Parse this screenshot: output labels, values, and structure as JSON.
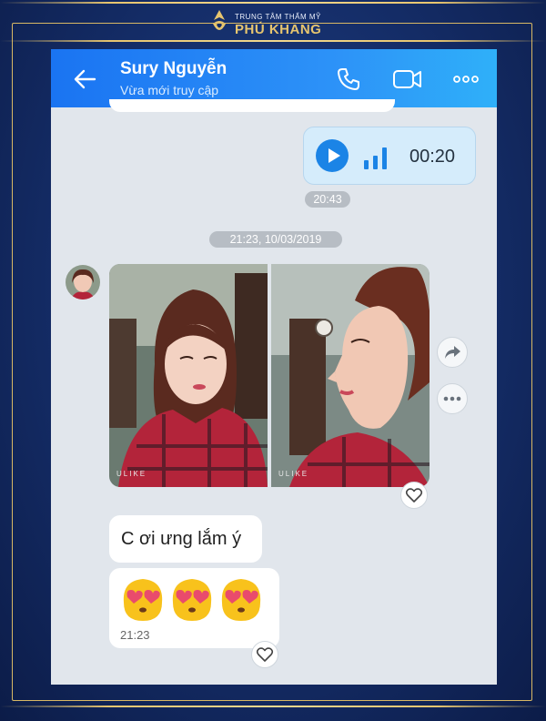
{
  "brand": {
    "tagline": "TRUNG TÂM THẨM MỸ",
    "name": "PHÚ KHANG",
    "accent": "#e7c56f"
  },
  "header": {
    "contact_name": "Sury Nguyễn",
    "status": "Vừa mới truy cập",
    "icons": [
      "back-arrow-icon",
      "phone-icon",
      "video-call-icon",
      "more-options-icon"
    ],
    "color": "#1a74f2"
  },
  "voice_message": {
    "duration": "00:20",
    "time": "20:43"
  },
  "date_separator": "21:23, 10/03/2019",
  "images": {
    "watermark": "ULIKE",
    "count": 2
  },
  "messages": [
    {
      "text": "C ơi ưng lắm ý"
    },
    {
      "emoji": [
        "smiling-face-with-heart-eyes",
        "smiling-face-with-heart-eyes",
        "smiling-face-with-heart-eyes"
      ],
      "time": "21:23"
    }
  ]
}
